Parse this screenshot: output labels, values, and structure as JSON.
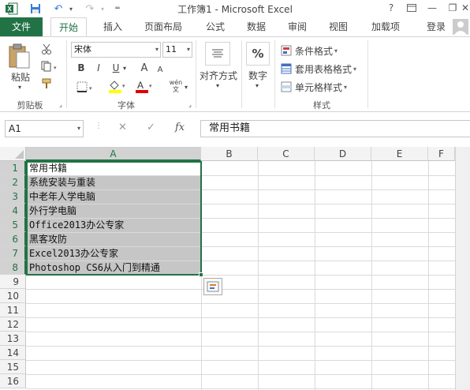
{
  "window": {
    "title": "工作簿1 - Microsoft Excel",
    "help": "?",
    "minimize": "—",
    "restore": "❐",
    "close": "✕"
  },
  "qat": {
    "save": "💾",
    "undo": "↶",
    "redo": "↷"
  },
  "tabs": [
    "文件",
    "开始",
    "插入",
    "页面布局",
    "公式",
    "数据",
    "审阅",
    "视图",
    "加载项"
  ],
  "account": {
    "signin": "登录"
  },
  "ribbon": {
    "clipboard": {
      "paste_label": "粘贴",
      "group_label": "剪贴板"
    },
    "font": {
      "name": "宋体",
      "size": "11",
      "bold": "B",
      "italic": "I",
      "underline": "U",
      "grow": "A",
      "shrink": "A",
      "wen": "wén",
      "group_label": "字体",
      "fill_color": "#ffff00",
      "font_color": "#e00000"
    },
    "alignment": {
      "label": "对齐方式"
    },
    "number": {
      "label": "数字",
      "symbol": "%"
    },
    "styles": {
      "conditional": "条件格式",
      "table": "套用表格格式",
      "cell": "单元格样式",
      "group_label": "样式"
    }
  },
  "formula_bar": {
    "name_box": "A1",
    "cancel": "✕",
    "enter": "✓",
    "fx": "fx",
    "content": "常用书籍"
  },
  "sheet": {
    "columns": [
      "A",
      "B",
      "C",
      "D",
      "E",
      "F"
    ],
    "rows": [
      "1",
      "2",
      "3",
      "4",
      "5",
      "6",
      "7",
      "8",
      "9",
      "10",
      "11",
      "12",
      "13",
      "14",
      "15",
      "16"
    ],
    "cells_A": [
      "常用书籍",
      "系统安装与重装",
      "中老年人学电脑",
      "外行学电脑",
      "Office2013办公专家",
      "黑客攻防",
      "Excel2013办公专家",
      "Photoshop CS6从入门到精通"
    ],
    "accent_color": "#217346"
  }
}
